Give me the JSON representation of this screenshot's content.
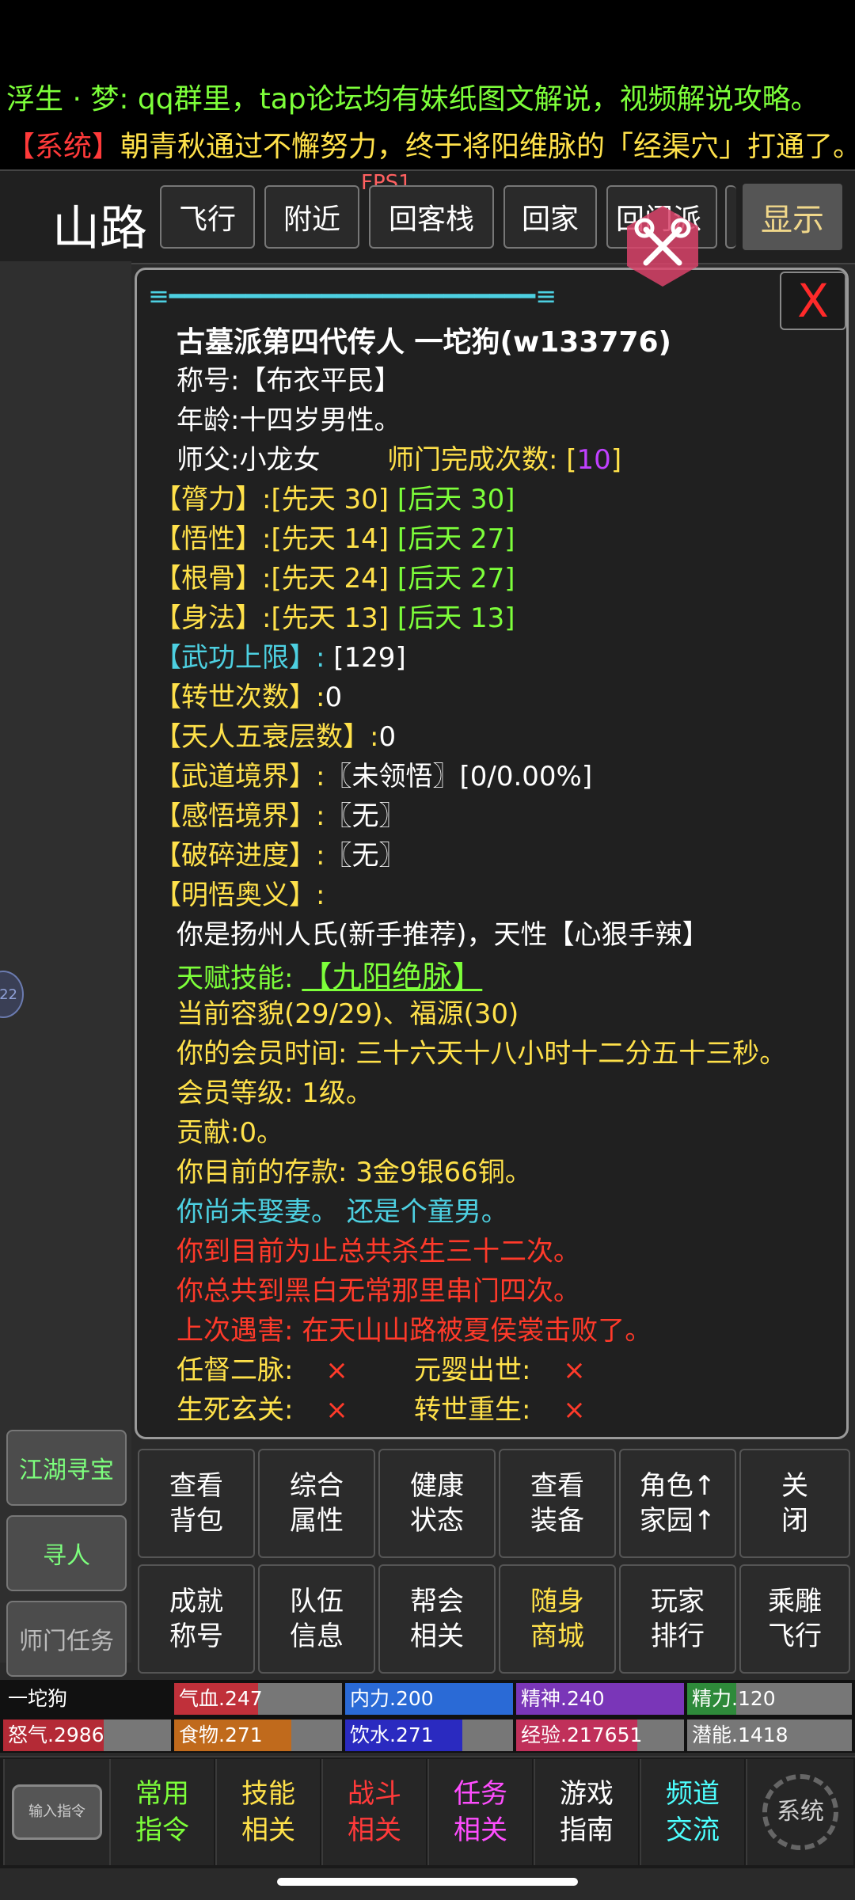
{
  "marquee": {
    "line1": "浮生 · 梦: qq群里，tap论坛均有妹纸图文解说，视频解说攻略。",
    "line2_tag": "【系统】",
    "line2_text": "朝青秋通过不懈努力，终于将阳维脉的「经渠穴」打通了。"
  },
  "location": {
    "name": "山路",
    "fps": "FPS1",
    "buttons": [
      "飞行",
      "附近",
      "回客栈",
      "回家",
      "回门派"
    ],
    "show_label": "显示"
  },
  "dialog": {
    "divider": "≡━━━━━━━━━━━━━━━━━━━━━━━━≡",
    "close_label": "X",
    "header": "古墓派第四代传人  一坨狗(w133776)",
    "title_label": "称号:",
    "title_value": "【布衣平民】",
    "age_label": "年龄:",
    "age_value": "十四岁男性。",
    "master_label": "师父:",
    "master_value": "小龙女",
    "sect_label": "师门完成次数:",
    "sect_open": "[",
    "sect_count": "10",
    "sect_close": "]",
    "attrs": [
      {
        "name": "【膂力】:",
        "innate": "[先天  30]",
        "acquired": "[后天  30]"
      },
      {
        "name": "【悟性】:",
        "innate": "[先天  14]",
        "acquired": "[后天  27]"
      },
      {
        "name": "【根骨】:",
        "innate": "[先天  24]",
        "acquired": "[后天  27]"
      },
      {
        "name": "【身法】:",
        "innate": "[先天  13]",
        "acquired": "[后天  13]"
      }
    ],
    "martial_limit_label": "【武功上限】:",
    "martial_limit_value": "[129]",
    "reincarnation_label": "【转世次数】:",
    "reincarnation_value": "0",
    "five_decay_label": "【天人五衰层数】:",
    "five_decay_value": "0",
    "realm_label": "【武道境界】:",
    "realm_value": "〖未领悟〗[0/0.00%]",
    "insight_label": "【感悟境界】:",
    "insight_value": "〖无〗",
    "break_label": "【破碎进度】:",
    "break_value": "〖无〗",
    "enlight_label": "【明悟奥义】:",
    "origin": "你是扬州人氏(新手推荐)，天性【心狠手辣】",
    "talent_label": "天赋技能:",
    "talent_value": "【九阳绝脉】",
    "looks": "当前容貌(29/29)、福源(30)",
    "vip_time": "你的会员时间: 三十六天十八小时十二分五十三秒。",
    "vip_level": "会员等级: 1级。",
    "contribution": "贡献:0。",
    "savings": "你目前的存款: 3金9银66铜。",
    "marriage": "你尚未娶妻。",
    "virgin": "还是个童男。",
    "kills": "你到目前为止总共杀生三十二次。",
    "deaths_visit": "你总共到黑白无常那里串门四次。",
    "last_death": "上次遇害: 在天山山路被夏侯裳击败了。",
    "meridian_a_label": "任督二脉:",
    "meridian_a_value": "×",
    "meridian_b_label": "元婴出世:",
    "meridian_b_value": "×",
    "meridian_c_label": "生死玄关:",
    "meridian_c_value": "×",
    "meridian_d_label": "转世重生:",
    "meridian_d_value": "×"
  },
  "side_buttons": [
    "江湖寻宝",
    "寻人",
    "师门任务"
  ],
  "side_icon_label": "22",
  "grid_buttons": [
    "查看\n背包",
    "综合\n属性",
    "健康\n状态",
    "查看\n装备",
    "角色↑\n家园↑",
    "关\n闭",
    "成就\n称号",
    "队伍\n信息",
    "帮会\n相关",
    "随身\n商城",
    "玩家\n排行",
    "乘雕\n飞行"
  ],
  "player_name": "一坨狗",
  "stats": [
    {
      "label": "气血.247",
      "fill_pct": 50,
      "color": "#c0303a"
    },
    {
      "label": "内力.200",
      "fill_pct": 100,
      "color": "#2a6ad6"
    },
    {
      "label": "精神.240",
      "fill_pct": 100,
      "color": "#7a36b8"
    },
    {
      "label": "精力.120",
      "fill_pct": 30,
      "color": "#2e8a3a"
    },
    {
      "label": "怒气.2986",
      "fill_pct": 60,
      "color": "#b42a36"
    },
    {
      "label": "食物.271",
      "fill_pct": 70,
      "color": "#c06a1c"
    },
    {
      "label": "饮水.271",
      "fill_pct": 70,
      "color": "#2a2ac0"
    },
    {
      "label": "经验.217651",
      "fill_pct": 72,
      "color": "#c0305a"
    },
    {
      "label": "潜能.1418",
      "fill_pct": 0,
      "color": "#777777"
    }
  ],
  "bottom_buttons": [
    {
      "label": "输入指令",
      "color": "#cfcfcf"
    },
    {
      "label": "常用\n指令",
      "color": "#7dff3a"
    },
    {
      "label": "技能\n相关",
      "color": "#ffe14a"
    },
    {
      "label": "战斗\n相关",
      "color": "#ff3a3a"
    },
    {
      "label": "任务\n相关",
      "color": "#ff4dff"
    },
    {
      "label": "游戏\n指南",
      "color": "#ffffff"
    },
    {
      "label": "频道\n交流",
      "color": "#4dffff"
    },
    {
      "label": "系统",
      "color": "#cfcfcf"
    }
  ]
}
